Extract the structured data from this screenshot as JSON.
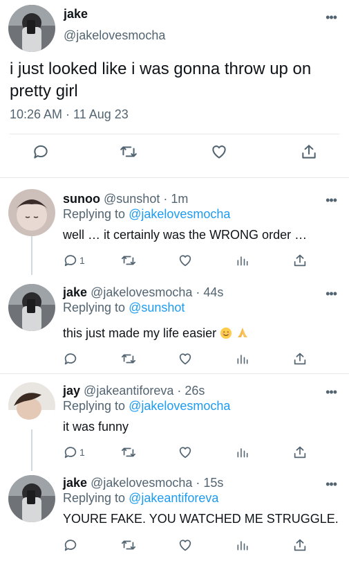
{
  "main": {
    "name": "jake",
    "handle": "@jakelovesmocha",
    "text": "i just looked like i was gonna throw up on pretty girl",
    "timestamp": "10:26 AM · 11 Aug 23",
    "more_icon": "more-icon",
    "actions": [
      "reply-icon",
      "retweet-icon",
      "like-icon",
      "share-icon"
    ]
  },
  "replies": [
    {
      "name": "sunoo",
      "handle_time": "@sunshot · 1m",
      "replying_label": "Replying to ",
      "replying_to": "@jakelovesmocha",
      "text": "well … it certainly was the WRONG order …",
      "reply_count": "1"
    },
    {
      "name": "jake",
      "handle_time": "@jakelovesmocha · 44s",
      "replying_label": "Replying to ",
      "replying_to": "@sunshot",
      "text": "this just made my life easier",
      "emojis": [
        "smiling-face",
        "folded-hands"
      ],
      "reply_count": ""
    },
    {
      "name": "jay",
      "handle_time": "@jakeantiforeva · 26s",
      "replying_label": "Replying to ",
      "replying_to": "@jakelovesmocha",
      "text": "it was funny",
      "reply_count": "1"
    },
    {
      "name": "jake",
      "handle_time": "@jakelovesmocha · 15s",
      "replying_label": "Replying to ",
      "replying_to": "@jakeantiforeva",
      "text": "YOURE FAKE. YOU WATCHED ME STRUGGLE.",
      "reply_count": ""
    }
  ],
  "colors": {
    "link": "#1d9bf0",
    "secondary": "#536471",
    "text": "#0f1419",
    "divider": "#e6e8ea"
  }
}
